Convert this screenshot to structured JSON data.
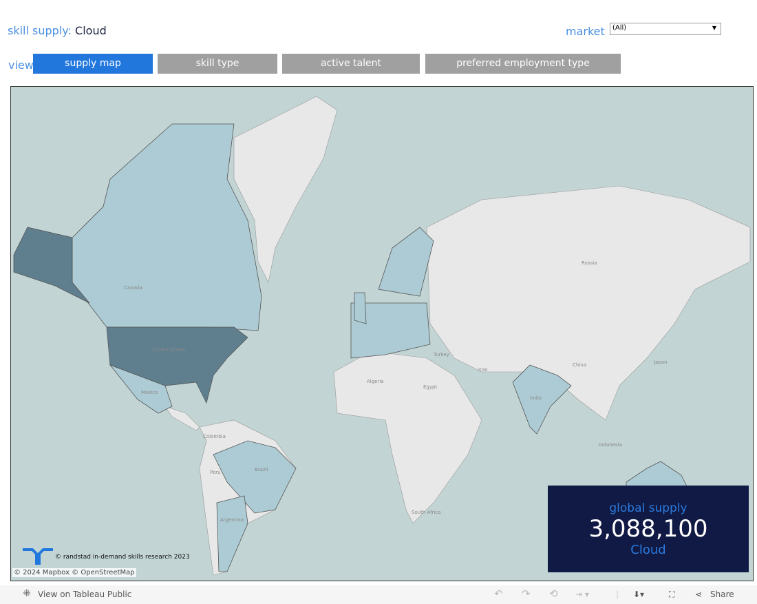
{
  "header": {
    "title_label": "skill supply:",
    "title_value": "Cloud",
    "market_label": "market",
    "market_value": "(All)",
    "view_label": "view"
  },
  "tabs": [
    {
      "label": "supply map",
      "active": true
    },
    {
      "label": "skill type"
    },
    {
      "label": "active talent"
    },
    {
      "label": "preferred employment type"
    }
  ],
  "map": {
    "country_labels": [
      "Canada",
      "United States",
      "Mexico",
      "Colombia",
      "Peru",
      "Brazil",
      "Argentina",
      "Algeria",
      "Egypt",
      "South Africa",
      "Turkey",
      "Iran",
      "Russia",
      "China",
      "Japan",
      "India",
      "Indonesia"
    ],
    "colors": {
      "ocean": "#c2d4d4",
      "land": "#e8e8e8",
      "supply_low": "#adcbd4",
      "supply_high": "#5f7f8e"
    },
    "credit": "© randstad in-demand skills research 2023",
    "attribution": "© 2024 Mapbox  © OpenStreetMap"
  },
  "kpi": {
    "label": "global supply",
    "value": "3,088,100",
    "skill": "Cloud"
  },
  "footer": {
    "view_on": "View on Tableau Public",
    "share": "Share"
  }
}
